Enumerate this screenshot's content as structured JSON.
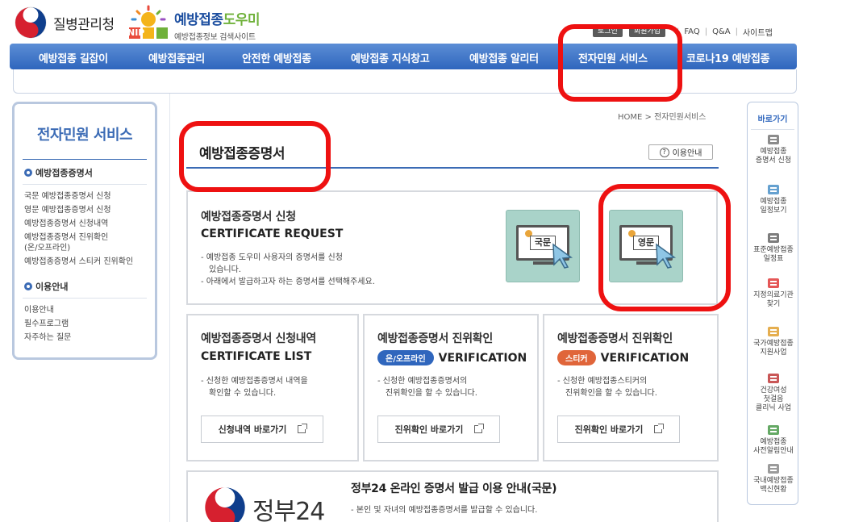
{
  "header": {
    "agency_name": "질병관리청",
    "site_logo_mark": "NIP",
    "site_title_main": "예방접종",
    "site_title_highlight": "도우미",
    "site_subtitle": "예방접종정보 검색사이트",
    "login": "로그인",
    "join": "회원가입",
    "util_links": [
      "FAQ",
      "Q&A",
      "사이트맵"
    ]
  },
  "nav": [
    "예방접종 길잡이",
    "예방접종관리",
    "안전한 예방접종",
    "예방접종 지식창고",
    "예방접종 알리터",
    "전자민원 서비스",
    "코로나19 예방접종"
  ],
  "sidebar": {
    "title": "전자민원 서비스",
    "sections": [
      {
        "heading": "예방접종증명서",
        "items": [
          "국문 예방접종증명서 신청",
          "영문 예방접종증명서 신청",
          "예방접종증명서 신청내역",
          "예방접종증명서 진위확인",
          "(온/오프라인)",
          "예방접종증명서 스티커 진위확인"
        ]
      },
      {
        "heading": "이용안내",
        "items": [
          "이용안내",
          "필수프로그램",
          "자주하는 질문"
        ]
      }
    ]
  },
  "quick": {
    "title": "바로가기",
    "items": [
      {
        "label": "예방접종\n증명서 신청",
        "icon": "printer-icon",
        "color": "#777777"
      },
      {
        "label": "예방접종\n일정보기",
        "icon": "calendar-icon",
        "color": "#4a90c8"
      },
      {
        "label": "표준예방접종\n일정표",
        "icon": "syringe-icon",
        "color": "#666666"
      },
      {
        "label": "지정의료기관\n찾기",
        "icon": "hospital-icon",
        "color": "#e03a3a"
      },
      {
        "label": "국가예방접종\n지원사업",
        "icon": "document-icon",
        "color": "#e0a030"
      },
      {
        "label": "건강여성\n첫걸음\n클리닉 사업",
        "icon": "box-icon",
        "color": "#c03a3a"
      },
      {
        "label": "예방접종\n사전알림안내",
        "icon": "speaker-icon",
        "color": "#4a9a4a"
      },
      {
        "label": "국내예방접종\n백신현황",
        "icon": "vaccine-icon",
        "color": "#8a8a8a"
      }
    ]
  },
  "breadcrumb": "HOME > 전자민원서비스",
  "page_title": "예방접종증명서",
  "guide_button": "이용안내",
  "request": {
    "title": "예방접종증명서 신청",
    "title_en": "CERTIFICATE REQUEST",
    "desc": [
      "- 예방접종 도우미 사용자의 증명서를 신청",
      "  있습니다.",
      "- 아래에서 발급하고자 하는 증명서를 선택해주세요."
    ],
    "korean_label": "국문",
    "english_label": "영문"
  },
  "cards": [
    {
      "title": "예방접종증명서 신청내역",
      "en": "CERTIFICATE LIST",
      "tag": "",
      "tag_color": "",
      "desc": [
        "- 신청한 예방접종증명서 내역을",
        "  확인할 수 있습니다."
      ],
      "button": "신청내역 바로가기"
    },
    {
      "title": "예방접종증명서 진위확인",
      "en": "VERIFICATION",
      "tag": "온/오프라인",
      "tag_color": "#2f66bd",
      "desc": [
        "- 신청한 예방접종증명서의",
        "  진위확인을 할 수 있습니다."
      ],
      "button": "진위확인 바로가기"
    },
    {
      "title": "예방접종증명서 진위확인",
      "en": "VERIFICATION",
      "tag": "스티커",
      "tag_color": "#e0653a",
      "desc": [
        "- 신청한 예방접종스티커의",
        "  진위확인을 할 수 있습니다."
      ],
      "button": "진위확인 바로가기"
    }
  ],
  "gov24": {
    "logo_text": "정부24",
    "title": "정부24 온라인 증명서 발급 이용 안내(국문)",
    "desc": [
      "- 본인 및 자녀의 예방접종증명서를 발급할 수 있습니다."
    ]
  },
  "colors": {
    "primary": "#2f66bd",
    "annotation": "#ee1111",
    "card_bg": "#a9d3c9"
  }
}
